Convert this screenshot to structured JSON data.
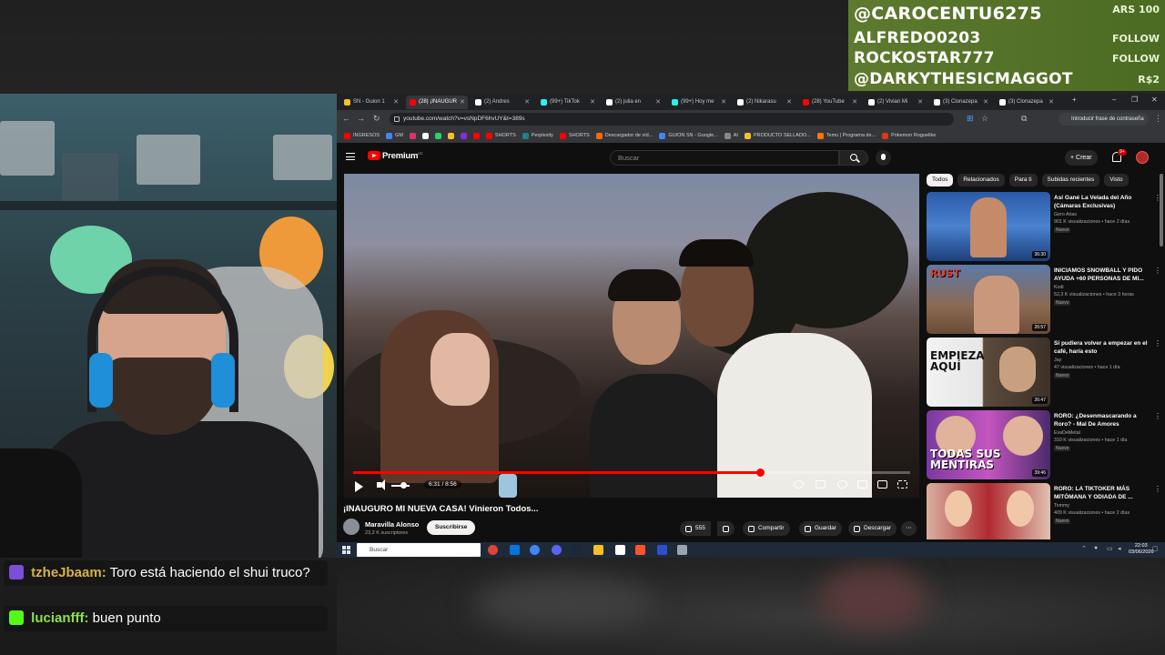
{
  "alerts": {
    "top": {
      "name": "@CAROCENTU6275",
      "tag": "ARS 100"
    },
    "rows": [
      {
        "name": "ALFREDO0203",
        "tag": "FOLLOW"
      },
      {
        "name": "ROCKOSTAR777",
        "tag": "FOLLOW"
      },
      {
        "name": "@DARKYTHESICMAGGOT",
        "tag": "R$2"
      }
    ]
  },
  "chat": {
    "messages": [
      {
        "user": "tzheJbaam:",
        "text": "Toro está haciendo el shui truco?"
      },
      {
        "user": "lucianfff:",
        "text": "buen punto"
      }
    ]
  },
  "browser": {
    "tabs": [
      {
        "label": "SN - Guion 1",
        "color": "#f6c026"
      },
      {
        "label": "(28) ¡INAUGUR",
        "color": "#ff0000",
        "active": true
      },
      {
        "label": "(2) Andres",
        "color": "#ffffff"
      },
      {
        "label": "(99+) TikTok",
        "color": "#ffffff"
      },
      {
        "label": "(2) julia en",
        "color": "#ffffff"
      },
      {
        "label": "(99+) Hoy me",
        "color": "#ffffff"
      },
      {
        "label": "(2) Nikarasu",
        "color": "#ffffff"
      },
      {
        "label": "(28) YouTube",
        "color": "#ff0000"
      },
      {
        "label": "(2) Vivian Mi",
        "color": "#ffffff"
      },
      {
        "label": "(3) Clonazepa",
        "color": "#ffffff"
      },
      {
        "label": "(3) Clonazepa",
        "color": "#ffffff"
      }
    ],
    "url": "youtube.com/watch?v=vsNpDF6hvUY&t=389s",
    "password_hint": "Introducir frase de contraseña",
    "bookmarks": [
      "INGRESOS",
      "GM",
      "SHORTS",
      "Perplexity",
      "SHORTS",
      "Descargador de víd...",
      "GUION SN - Google...",
      "AI",
      "PRODUCTO SELLADO...",
      "Temu | Programa de...",
      "Pokemon Roguelike"
    ]
  },
  "youtube": {
    "brand": "Premium",
    "brand_sup": "ES",
    "search_placeholder": "Buscar",
    "create_label": "Crear",
    "notif_count": "9+",
    "player": {
      "time": "6:31 / 8:56",
      "progress": 0.73
    },
    "video": {
      "title": "¡INAUGURO MI NUEVA CASA! Vinieron Todos...",
      "channel": "Maravilla Alonso",
      "subs": "23,2 K suscriptores",
      "subscribe": "Suscribirse",
      "likes": "555",
      "share": "Compartir",
      "save": "Guardar",
      "download": "Descargar"
    },
    "chips": [
      {
        "label": "Todos",
        "active": true
      },
      {
        "label": "Relacionados"
      },
      {
        "label": "Para ti"
      },
      {
        "label": "Subidas recientes"
      },
      {
        "label": "Visto"
      }
    ],
    "recommendations": [
      {
        "title": "Así Gané La Velada del Año (Cámaras Exclusivas)",
        "channel": "Gero Arias",
        "meta": "901 K visualizaciones • hace 2 días",
        "badge": "Nuevo",
        "duration": "36:30",
        "overlay": ""
      },
      {
        "title": "INICIAMOS SNOWBALL Y PIDO AYUDA +60 PERSONAS DE MI...",
        "channel": "Kodi",
        "meta": "52,3 K visualizaciones • hace 3 horas",
        "badge": "Nuevo",
        "duration": "26:57",
        "overlay": "RUST"
      },
      {
        "title": "Si pudiera volver a empezar en el café, haría esto",
        "channel": "Jay",
        "meta": "47 visualizaciones • hace 1 día",
        "badge": "Nuevo",
        "duration": "26:47",
        "overlay": "EMPIEZA AQUÍ"
      },
      {
        "title": "RORO: ¿Desenmascarando a Roro? - Mal De Amores",
        "channel": "EvaDeMetal",
        "meta": "310 K visualizaciones • hace 1 día",
        "badge": "Nuevo",
        "duration": "39:46",
        "overlay": "TODAS SUS MENTIRAS"
      },
      {
        "title": "RORO: LA TIKTOKER MÁS MITÓMANA Y ODIADA DE ...",
        "channel": "Tommy",
        "meta": "409 K visualizaciones • hace 2 días",
        "badge": "Nuevo",
        "duration": "",
        "overlay": ""
      }
    ]
  },
  "taskbar": {
    "search": "Buscar",
    "time": "22:03",
    "date": "03/06/2026"
  }
}
